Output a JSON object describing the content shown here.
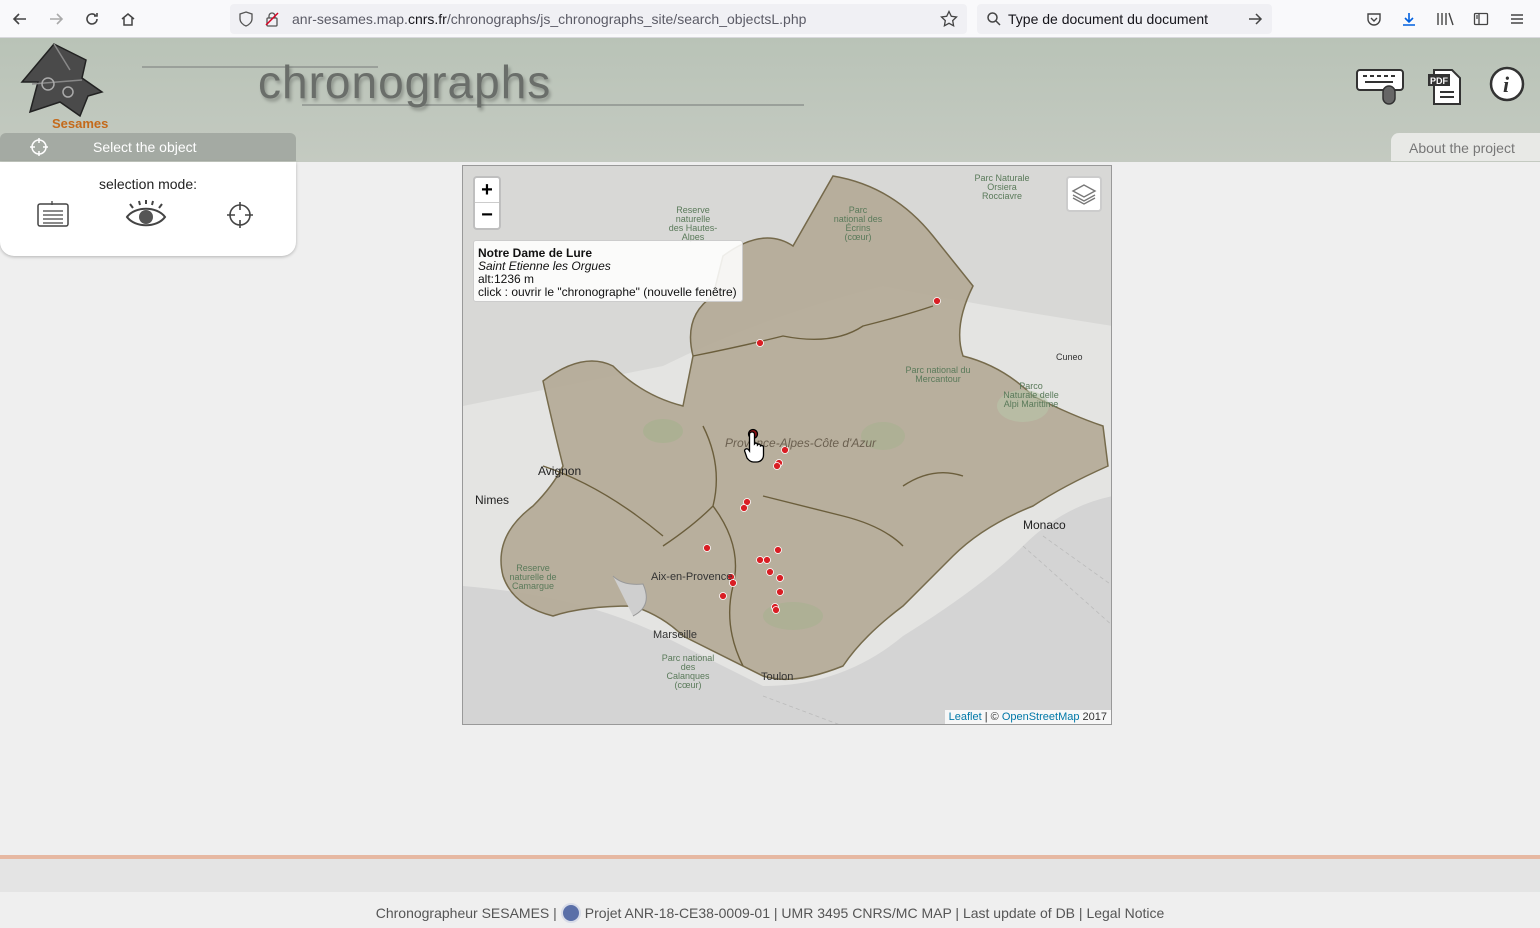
{
  "browser": {
    "url_prefix": "anr-sesames.map.",
    "url_domain": "cnrs.fr",
    "url_path": "/chronographs/js_chronographs_site/search_objectsL.php",
    "search_text": "Type de document  du document"
  },
  "header": {
    "title": "chronographs",
    "logo_text": "Sesames",
    "select_tab": "Select the object",
    "about_tab": "About the project"
  },
  "selection_panel": {
    "label": "selection mode:"
  },
  "map": {
    "zoom_in": "+",
    "zoom_out": "−",
    "popup": {
      "title": "Notre Dame de Lure",
      "subtitle": "Saint Etienne les Orgues",
      "altitude": "alt:1236 m",
      "action": "click : ouvrir le \"chronographe\" (nouvelle fenêtre)"
    },
    "attribution": {
      "leaflet": "Leaflet",
      "sep": " | © ",
      "osm": "OpenStreetMap",
      "year": " 2017"
    },
    "places": {
      "avignon": "Avignon",
      "nimes": "Nimes",
      "aix": "Aix-en-Provence",
      "marseille": "Marseille",
      "toulon": "Toulon",
      "monaco": "Monaco",
      "cuneo": "Cuneo",
      "region": "Provence-Alpes-Côte d'Azur",
      "camargue": "Reserve naturelle de Camargue",
      "calanques": "Parc national des Calanques (cœur)",
      "ecrins": "Parc national des Écrins (cœur)",
      "mercantour": "Parc national du Mercantour",
      "queyras": "Parc Naturale Orsiera Rocciavre",
      "alpi": "Parco Naturale delle Alpi Marittime",
      "reserve_n": "Reserve naturelle des Hautes-Alpes"
    }
  },
  "footer": {
    "part1": "Chronographeur SESAMES |",
    "part2": "Projet ANR-18-CE38-0009-01 | UMR 3495 CNRS/MC MAP | Last update of DB | Legal Notice"
  }
}
